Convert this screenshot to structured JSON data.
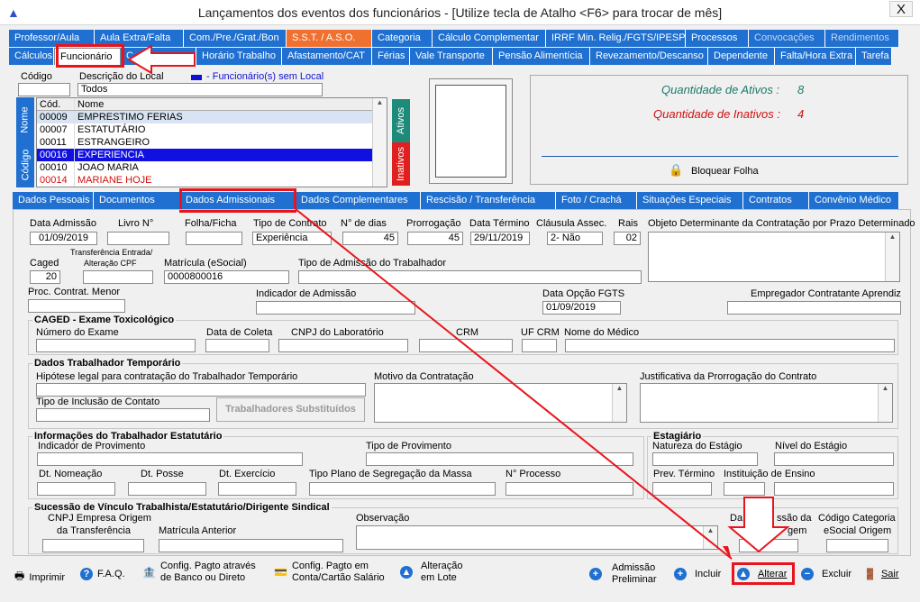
{
  "window": {
    "title": "Lançamentos dos eventos dos funcionários - [Utilize tecla de Atalho <F6> para trocar de mês]",
    "close": "X"
  },
  "tabs_row1": [
    "Professor/Aula",
    "Aula Extra/Falta",
    "Com./Pre./Grat./Bon",
    "S.S.T. / A.S.O.",
    "Categoria",
    "Cálculo Complementar",
    "IRRF Min. Relig./FGTS/IPESP",
    "Processos",
    "Convocações",
    "Rendimentos"
  ],
  "tabs_row2": [
    "Cálculos",
    "Funcionário",
    "C",
    "Horário Trabalho",
    "Afastamento/CAT",
    "Férias",
    "Vale Transporte",
    "Pensão Alimentícia",
    "Revezamento/Descanso",
    "Dependente",
    "Falta/Hora Extra",
    "Tarefa"
  ],
  "filter": {
    "codigo_label": "Código",
    "descricao_label": "Descrição do Local",
    "descricao_value": "Todos",
    "legend": "- Funcionário(s) sem Local"
  },
  "list": {
    "headers": [
      "Cód.",
      "Nome"
    ],
    "rows": [
      [
        "00009",
        "EMPRESTIMO FERIAS"
      ],
      [
        "00007",
        "ESTATUTÁRIO"
      ],
      [
        "00011",
        "ESTRANGEIRO"
      ],
      [
        "00016",
        "EXPERIENCIA"
      ],
      [
        "00010",
        "JOAO MARIA"
      ],
      [
        "00014",
        "MARIANE HOJE"
      ]
    ],
    "side_nome": "Nome",
    "side_codigo": "Código",
    "ativos": "Ativos",
    "inativos": "Inativos"
  },
  "info": {
    "ativos_label": "Quantidade de Ativos :",
    "ativos_value": "8",
    "inativos_label": "Quantidade de Inativos :",
    "inativos_value": "4",
    "bloquear": "Bloquear Folha"
  },
  "subtabs": [
    "Dados Pessoais",
    "Documentos",
    "Dados Admissionais",
    "Dados Complementares",
    "Rescisão / Transferência",
    "Foto / Crachá",
    "Situações Especiais",
    "Contratos",
    "Convênio Médico"
  ],
  "form": {
    "data_admissao": {
      "label": "Data Admissão",
      "value": "01/09/2019"
    },
    "livro": {
      "label": "Livro N°",
      "value": ""
    },
    "folha": {
      "label": "Folha/Ficha",
      "value": ""
    },
    "tipo_contrato": {
      "label": "Tipo de Contrato",
      "value": "Experiência"
    },
    "n_dias": {
      "label": "N° de dias",
      "value": "45"
    },
    "prorrogacao": {
      "label": "Prorrogação",
      "value": "45"
    },
    "data_termino": {
      "label": "Data Término",
      "value": "29/11/2019"
    },
    "clausula": {
      "label": "Cláusula Assec.",
      "value": "2- Não"
    },
    "rais": {
      "label": "Rais",
      "value": "02"
    },
    "objeto": {
      "label": "Objeto Determinante da Contratação por Prazo Determinado"
    },
    "caged": {
      "label": "Caged",
      "value": "20"
    },
    "transf_line1": "Transferência Entrada/",
    "transf_line2": "Alteração CPF",
    "matricula": {
      "label": "Matrícula (eSocial)",
      "value": "0000800016"
    },
    "tipo_admissao": {
      "label": "Tipo de Admissão do Trabalhador"
    },
    "proc_contrat": {
      "label": "Proc. Contrat. Menor"
    },
    "indicador_adm": {
      "label": "Indicador de Admissão"
    },
    "data_opcao": {
      "label": "Data Opção FGTS",
      "value": "01/09/2019"
    },
    "empregador_aprendiz": {
      "label": "Empregador Contratante Aprendiz"
    }
  },
  "caged_group": {
    "title": "CAGED - Exame Toxicológico",
    "numero": "Número do Exame",
    "data_coleta": "Data de Coleta",
    "cnpj": "CNPJ do Laboratório",
    "crm": "CRM",
    "uf_crm": "UF CRM",
    "medico": "Nome do Médico"
  },
  "temp_group": {
    "title": "Dados Trabalhador Temporário",
    "hipotese": "Hipótese legal para contratação do Trabalhador Temporário",
    "motivo": "Motivo da Contratação",
    "justificativa": "Justificativa da Prorrogação do Contrato",
    "tipo_inclusao": "Tipo de Inclusão de Contato",
    "substituidos": "Trabalhadores Substituídos"
  },
  "estat_group": {
    "title": "Informações do Trabalhador Estatutário",
    "indicador": "Indicador de Provimento",
    "tipo_prov": "Tipo de Provimento",
    "nomeacao": "Dt. Nomeação",
    "posse": "Dt. Posse",
    "exercicio": "Dt. Exercício",
    "segregacao": "Tipo Plano de Segregação da Massa",
    "processo": "N° Processo"
  },
  "estagio_group": {
    "title": "Estagiário",
    "natureza": "Natureza do Estágio",
    "nivel": "Nível do Estágio",
    "prev_termino": "Prev. Término",
    "instituicao": "Instituição de Ensino"
  },
  "sucessao_group": {
    "title": "Sucessão de Vínculo Trabalhista/Estatutário/Dirigente Sindical",
    "cnpj1": "CNPJ Empresa Origem",
    "cnpj2": "da Transferência",
    "matricula_ant": "Matrícula Anterior",
    "observacao": "Observação",
    "data_adm1": "Da",
    "data_adm2": "ssão da",
    "data_adm3": "gem",
    "cod_cat1": "Código Categoria",
    "cod_cat2": "eSocial Origem"
  },
  "buttons": {
    "imprimir": "Imprimir",
    "faq": "F.A.Q.",
    "config1_l1": "Config. Pagto através",
    "config1_l2": "de Banco ou Direto",
    "config2_l1": "Config. Pagto em",
    "config2_l2": "Conta/Cartão Salário",
    "lote_l1": "Alteração",
    "lote_l2": "em Lote",
    "adm_l1": "Admissão",
    "adm_l2": "Preliminar",
    "incluir": "Incluir",
    "alterar": "Alterar",
    "excluir": "Excluir",
    "sair": "Sair"
  },
  "colors": {
    "tab_blue": "#1f70d0",
    "tab_orange": "#f07030",
    "annotation_red": "#e8141c",
    "ativos_green": "#1e8a7a",
    "inativos_red": "#e02020"
  }
}
